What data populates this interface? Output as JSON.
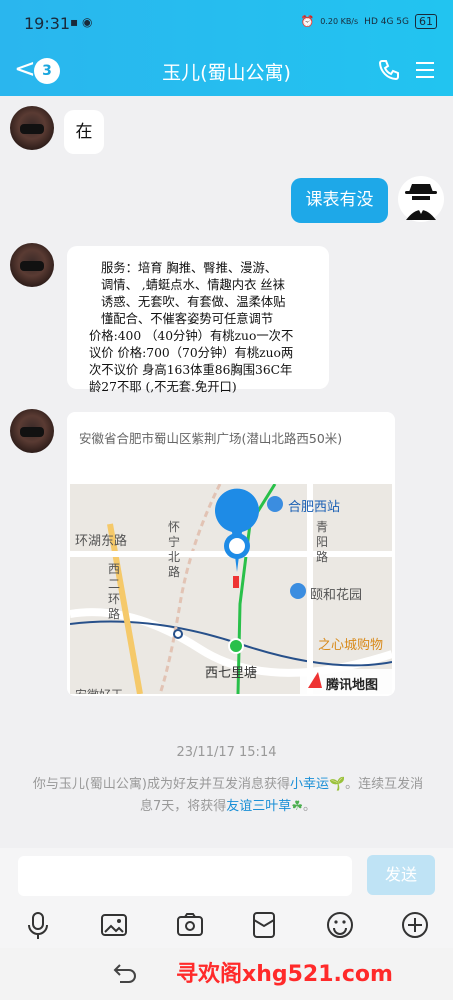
{
  "status_bar": {
    "time": "19:31",
    "net_speed": "0.20 KB/s",
    "signal": "HD 4G 5G",
    "battery": "61"
  },
  "header": {
    "back_count": "3",
    "title": "玉儿(蜀山公寓)"
  },
  "messages": {
    "m1": "在",
    "m2": "课表有没",
    "m3_lines": [
      "服务：培育 胸推、臀推、漫游、",
      "调情、 ,蜻蜓点水、情趣内衣 丝袜",
      "诱惑、无套吹、有套做、温柔体贴",
      "懂配合、不催客姿势可任意调节",
      "价格:400 （40分钟）有桃zuo一次不",
      "议价 价格:700（70分钟）有桃zuo两",
      "次不议价 身高163体重86胸围36C年",
      "龄27不耶 (,不无套.免开口)"
    ],
    "m4_address": "安徽省合肥市蜀山区紫荆广场(潜山北路西50米)"
  },
  "map": {
    "labels": {
      "west_station": "合肥西站",
      "huanhu": "环湖东路",
      "huaining": "怀宁北路",
      "qingyang": "青阳路",
      "xierhuan": "西二环路",
      "yihe": "颐和花园",
      "mall": "之心城购物",
      "xiqili": "西七里塘",
      "brand": "腾讯地图",
      "cut": "安徽好王"
    }
  },
  "timestamp": "23/11/17 15:14",
  "system_message": {
    "part1": "你与玉儿(蜀山公寓)成为好友并互发消息获得",
    "link1": "小幸运",
    "part2": "。连续互发消息7天，将获得",
    "link2": "友谊三叶草",
    "part3": "。"
  },
  "input": {
    "placeholder": "",
    "send_label": "发送"
  },
  "watermark": "寻欢阁xhg521.com",
  "colors": {
    "header": "#22c4f0",
    "send_disabled": "#bfe3f5",
    "link": "#1a8fd6"
  }
}
